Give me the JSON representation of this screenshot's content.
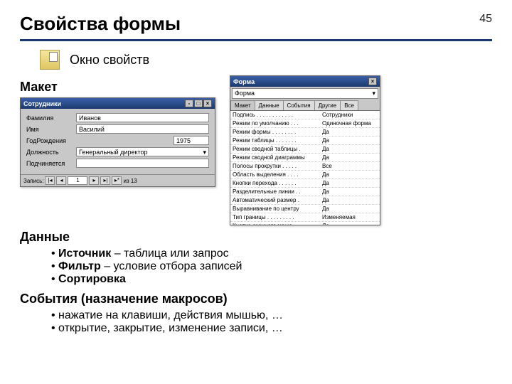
{
  "page_number": "45",
  "title": "Свойства формы",
  "subhead": "Окно свойств",
  "section_layout": "Макет",
  "section_data": "Данные",
  "data_bullets": {
    "b1_bold": "Источник",
    "b1_rest": " – таблица или запрос",
    "b2_bold": "Фильтр",
    "b2_rest": " – условие отбора записей",
    "b3_bold": "Сортировка",
    "b3_rest": ""
  },
  "section_events": "События (назначение макросов)",
  "event_bullets": {
    "e1": "нажатие на клавиши, действия мышью, …",
    "e2": "открытие, закрытие, изменение записи, …"
  },
  "form_win": {
    "title": "Сотрудники",
    "fields": [
      {
        "label": "Фамилия",
        "value": "Иванов"
      },
      {
        "label": "Имя",
        "value": "Василий"
      },
      {
        "label": "ГодРождения",
        "value": "1975",
        "short": true
      },
      {
        "label": "Должность",
        "value": "Генеральный директор",
        "select": true
      },
      {
        "label": "Подчиняется",
        "value": ""
      }
    ],
    "nav": {
      "label": "Запись:",
      "pos": "1",
      "total": "из 13"
    }
  },
  "props_win": {
    "title": "Форма",
    "selector": "Форма",
    "tabs": [
      "Макет",
      "Данные",
      "События",
      "Другие",
      "Все"
    ],
    "active_tab": 0,
    "rows": [
      {
        "n": "Подпись . . . . . . . . . . . .",
        "v": "Сотрудники"
      },
      {
        "n": "Режим по умолчанию . . .",
        "v": "Одиночная форма"
      },
      {
        "n": "Режим формы . . . . . . . .",
        "v": "Да"
      },
      {
        "n": "Режим таблицы . . . . . . .",
        "v": "Да"
      },
      {
        "n": "Режим сводной таблицы .",
        "v": "Да"
      },
      {
        "n": "Режим сводной диаграммы",
        "v": "Да"
      },
      {
        "n": "Полосы прокрутки . . . . .",
        "v": "Все"
      },
      {
        "n": "Область выделения . . . .",
        "v": "Да"
      },
      {
        "n": "Кнопки перехода . . . . . .",
        "v": "Да"
      },
      {
        "n": "Разделительные линии . .",
        "v": "Да"
      },
      {
        "n": "Автоматический размер .",
        "v": "Да"
      },
      {
        "n": "Выравнивание по центру",
        "v": "Да"
      },
      {
        "n": "Тип границы . . . . . . . . .",
        "v": "Изменяемая"
      },
      {
        "n": "Кнопка оконного меню . .",
        "v": "Да"
      }
    ]
  }
}
